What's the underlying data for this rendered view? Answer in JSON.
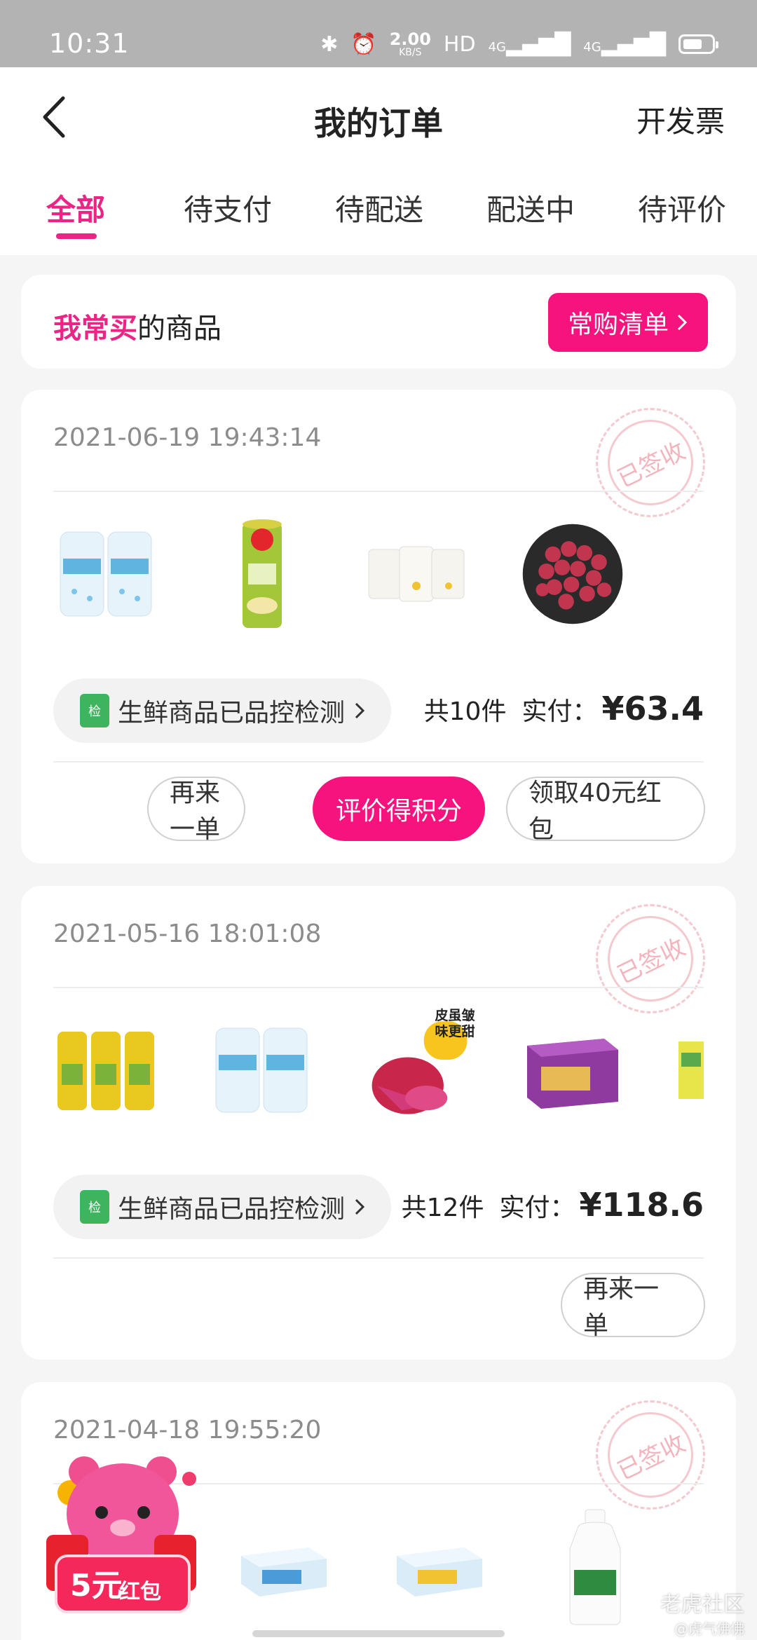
{
  "status": {
    "time": "10:31",
    "speed_value": "2.00",
    "speed_unit": "KB/S",
    "hd": "HD",
    "net1": "4G",
    "net2": "4G"
  },
  "header": {
    "title": "我的订单",
    "invoice": "开发票"
  },
  "tabs": [
    {
      "label": "全部",
      "active": true
    },
    {
      "label": "待支付"
    },
    {
      "label": "待配送"
    },
    {
      "label": "配送中"
    },
    {
      "label": "待评价"
    }
  ],
  "frequent": {
    "label_highlight": "我常买",
    "label_rest": "的商品",
    "button": "常购清单"
  },
  "orders": [
    {
      "date": "2021-06-19 19:43:14",
      "stamp": "已签收",
      "inspection": "生鲜商品已品控检测",
      "inspect_icon": "检",
      "count": "共10件",
      "paid_label": "实付：",
      "price": "¥63.4",
      "products": [
        "yogurt-drink-cans",
        "lays-chips-tube",
        "yogurt-cups",
        "red-grapes"
      ],
      "buttons": [
        "再来一单",
        "评价得积分",
        "领取40元红包"
      ]
    },
    {
      "date": "2021-05-16 18:01:08",
      "stamp": "已签收",
      "inspection": "生鲜商品已品控检测",
      "inspect_icon": "检",
      "count": "共12件",
      "paid_label": "实付：",
      "price": "¥118.6",
      "products": [
        "pineapple-beer-cans",
        "yogurt-drink-cans",
        "dragon-fruit",
        "ice-cream-box",
        "juice-box"
      ],
      "product_badge": "皮虽皱味更甜",
      "buttons": [
        "再来一单"
      ]
    },
    {
      "date": "2021-04-18 19:55:20",
      "stamp": "已签收",
      "products": [
        "yogurt-pack",
        "yogurt-pack",
        "milk-bottle"
      ]
    }
  ],
  "floating": {
    "amount": "5元",
    "label": "红包"
  },
  "watermark": {
    "name": "老虎社区",
    "sub": "@虎气佛佛"
  },
  "colors": {
    "accent": "#ea2586",
    "button_pink": "#f7137e",
    "stamp": "#f3b4bd"
  }
}
